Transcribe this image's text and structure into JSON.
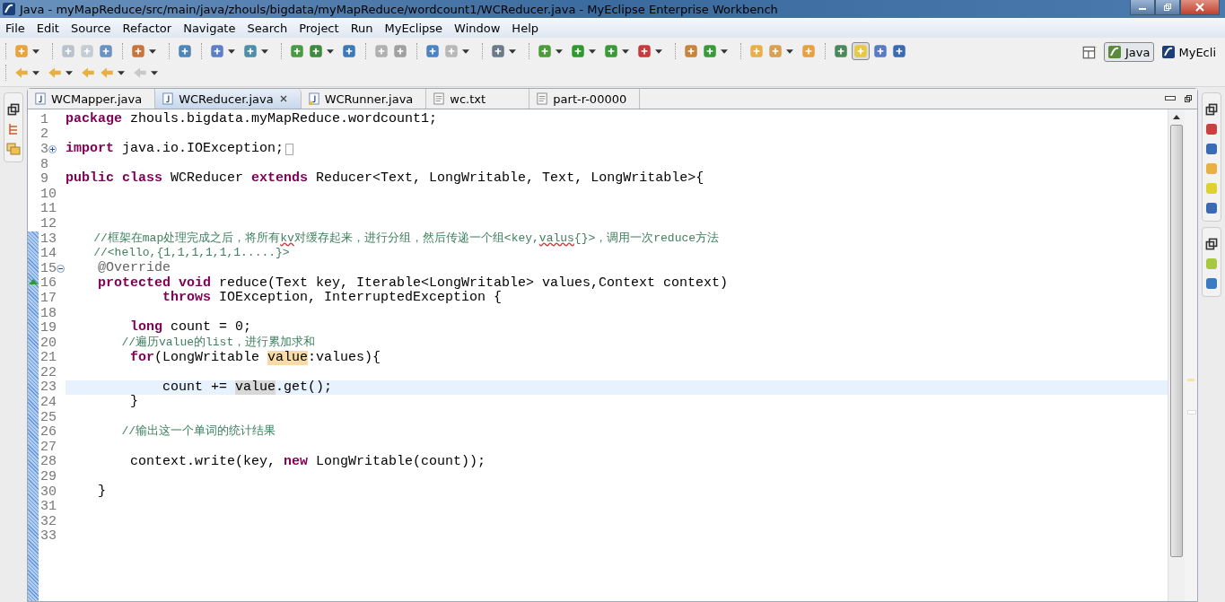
{
  "window": {
    "title": "Java - myMapReduce/src/main/java/zhouls/bigdata/myMapReduce/wordcount1/WCReducer.java - MyEclipse Enterprise Workbench"
  },
  "menu": [
    "File",
    "Edit",
    "Source",
    "Refactor",
    "Navigate",
    "Search",
    "Project",
    "Run",
    "MyEclipse",
    "Window",
    "Help"
  ],
  "perspectives": [
    {
      "label": "Java",
      "selected": true
    },
    {
      "label": "MyEcli",
      "selected": false
    }
  ],
  "tabs": [
    {
      "label": "WCMapper.java",
      "kind": "java",
      "selected": false
    },
    {
      "label": "WCReducer.java",
      "kind": "java",
      "selected": true
    },
    {
      "label": "WCRunner.java",
      "kind": "java-warn",
      "selected": false
    },
    {
      "label": "wc.txt",
      "kind": "text",
      "selected": false
    },
    {
      "label": "part-r-00000",
      "kind": "text",
      "selected": false
    }
  ],
  "editor": {
    "lines": [
      {
        "number": "1",
        "tokens": [
          {
            "kind": "kw",
            "text": "package"
          },
          {
            "kind": "plain",
            "text": " zhouls.bigdata.myMapReduce.wordcount1;"
          }
        ]
      },
      {
        "number": "2"
      },
      {
        "number": "3",
        "expanded": false,
        "folded": true,
        "tokens": [
          {
            "kind": "kw",
            "text": "import"
          },
          {
            "kind": "plain",
            "text": " java.io.IOException;"
          }
        ]
      },
      {
        "number": "8"
      },
      {
        "number": "9",
        "tokens": [
          {
            "kind": "kw",
            "text": "public class"
          },
          {
            "kind": "plain",
            "text": " WCReducer "
          },
          {
            "kind": "kw",
            "text": "extends"
          },
          {
            "kind": "plain",
            "text": " Reducer<Text, LongWritable, Text, LongWritable>{"
          }
        ]
      },
      {
        "number": "10"
      },
      {
        "number": "11"
      },
      {
        "number": "12"
      },
      {
        "number": "13",
        "tokens": [
          {
            "kind": "cm",
            "text": "    //框架在map处理完成之后，将所有"
          },
          {
            "kind": "cm-err",
            "text": "kv"
          },
          {
            "kind": "cm",
            "text": "对缓存起来，进行分组，然后传递一个组<key,"
          },
          {
            "kind": "cm-err",
            "text": "valus"
          },
          {
            "kind": "cm",
            "text": "{}>，调用一次reduce方法"
          }
        ]
      },
      {
        "number": "14",
        "tokens": [
          {
            "kind": "cm",
            "text": "    //<hello,{1,1,1,1,1,1.....}>"
          }
        ]
      },
      {
        "number": "15",
        "expanded": true,
        "tokens": [
          {
            "kind": "ann",
            "text": "    @Override"
          }
        ]
      },
      {
        "number": "16",
        "override": true,
        "tokens": [
          {
            "kind": "kw",
            "text": "    protected void"
          },
          {
            "kind": "plain",
            "text": " reduce(Text key, Iterable<LongWritable> values,Context context)"
          }
        ]
      },
      {
        "number": "17",
        "tokens": [
          {
            "kind": "kw",
            "text": "            throws"
          },
          {
            "kind": "plain",
            "text": " IOException, InterruptedException {"
          }
        ]
      },
      {
        "number": "18"
      },
      {
        "number": "19",
        "tokens": [
          {
            "kind": "kw",
            "text": "        long"
          },
          {
            "kind": "plain",
            "text": " count = 0;"
          }
        ]
      },
      {
        "number": "20",
        "tokens": [
          {
            "kind": "cm",
            "text": "        //遍历value的list，进行累加求和"
          }
        ]
      },
      {
        "number": "21",
        "tokens": [
          {
            "kind": "kw",
            "text": "        for"
          },
          {
            "kind": "plain",
            "text": "(LongWritable "
          },
          {
            "kind": "occ-write",
            "text": "value"
          },
          {
            "kind": "plain",
            "text": ":values){"
          }
        ]
      },
      {
        "number": "22"
      },
      {
        "number": "23",
        "current": true,
        "tokens": [
          {
            "kind": "plain",
            "text": "            count += "
          },
          {
            "kind": "occ-read",
            "text": "value"
          },
          {
            "kind": "plain",
            "text": ".get();"
          }
        ]
      },
      {
        "number": "24",
        "tokens": [
          {
            "kind": "plain",
            "text": "        }"
          }
        ]
      },
      {
        "number": "25"
      },
      {
        "number": "26",
        "tokens": [
          {
            "kind": "cm",
            "text": "        //输出这一个单词的统计结果"
          }
        ]
      },
      {
        "number": "27"
      },
      {
        "number": "28",
        "tokens": [
          {
            "kind": "plain",
            "text": "        context.write(key, "
          },
          {
            "kind": "kw",
            "text": "new"
          },
          {
            "kind": "plain",
            "text": " LongWritable(count));"
          }
        ]
      },
      {
        "number": "29"
      },
      {
        "number": "30",
        "tokens": [
          {
            "kind": "plain",
            "text": "    }"
          }
        ]
      },
      {
        "number": "31"
      },
      {
        "number": "32"
      },
      {
        "number": "33"
      }
    ]
  }
}
